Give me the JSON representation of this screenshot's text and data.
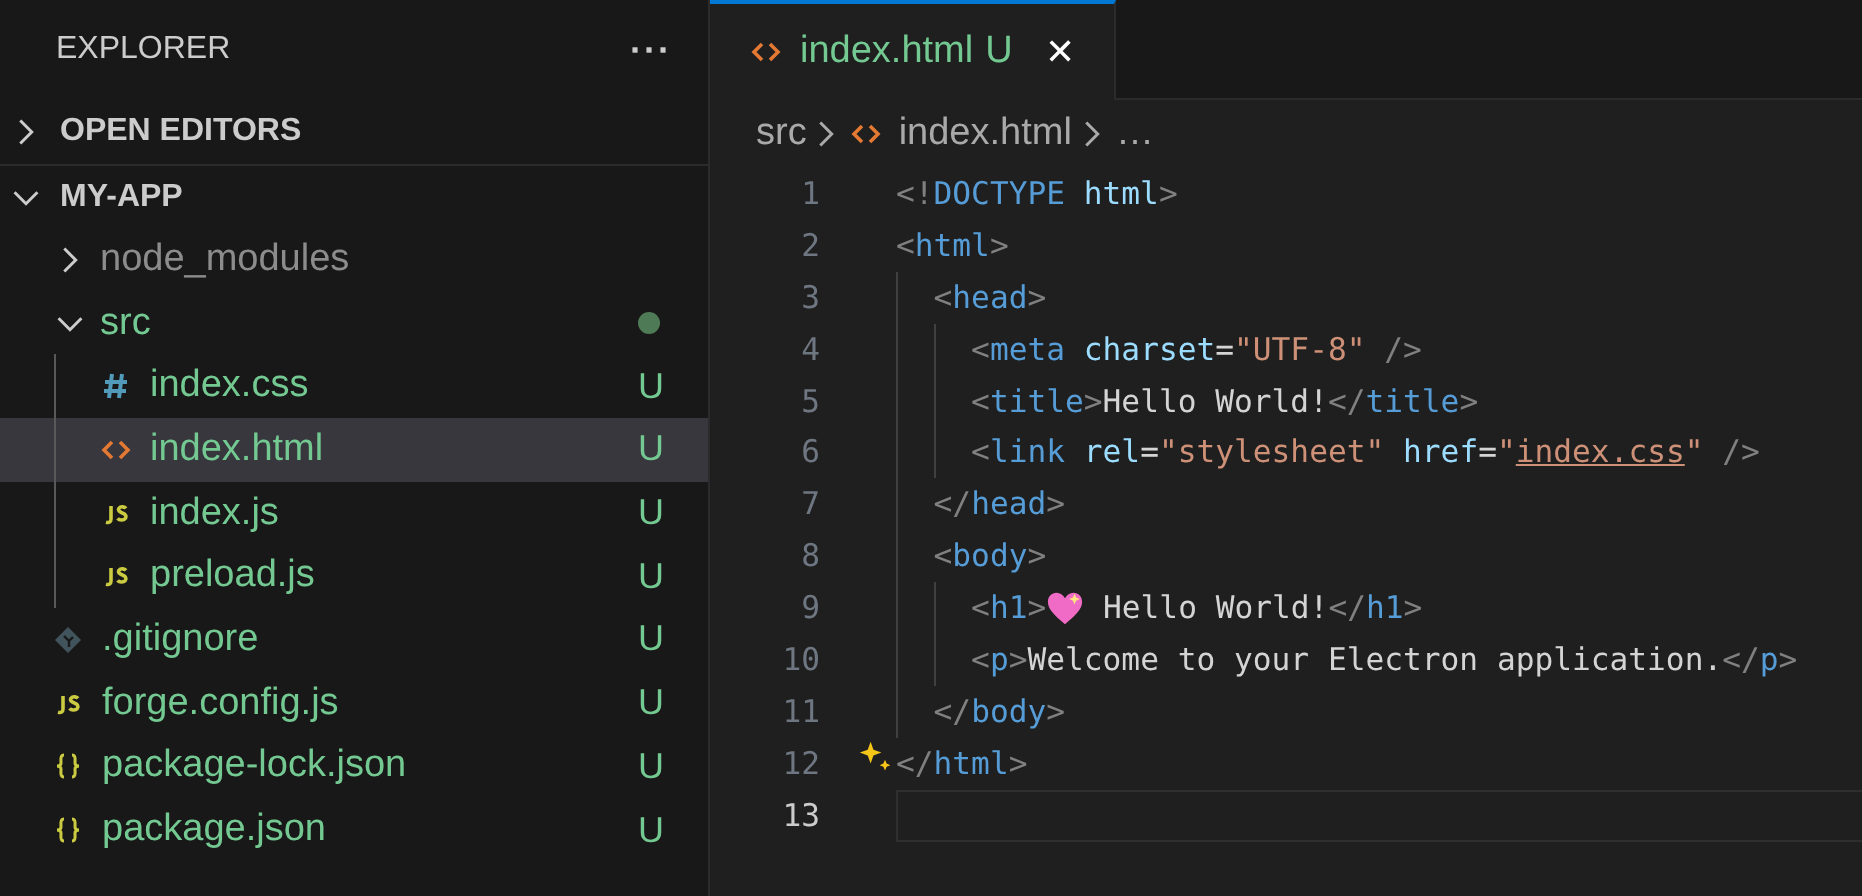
{
  "sidebar": {
    "title": "EXPLORER",
    "more": "···",
    "sections": [
      {
        "label": "OPEN EDITORS",
        "expanded": false
      },
      {
        "label": "MY-APP",
        "expanded": true,
        "items": [
          {
            "name": "node_modules",
            "kind": "folder",
            "expanded": false,
            "ignored": true,
            "selected": false
          },
          {
            "name": "src",
            "kind": "folder",
            "expanded": true,
            "ignored": false,
            "dot": true,
            "selected": false,
            "children": [
              {
                "name": "index.css",
                "kind": "css",
                "ignored": false,
                "badge": "U",
                "selected": false
              },
              {
                "name": "index.html",
                "kind": "html",
                "ignored": false,
                "badge": "U",
                "selected": true
              },
              {
                "name": "index.js",
                "kind": "js",
                "ignored": false,
                "badge": "U",
                "selected": false
              },
              {
                "name": "preload.js",
                "kind": "js",
                "ignored": false,
                "badge": "U",
                "selected": false
              }
            ]
          },
          {
            "name": ".gitignore",
            "kind": "git",
            "ignored": false,
            "badge": "U",
            "selected": false
          },
          {
            "name": "forge.config.js",
            "kind": "js",
            "ignored": false,
            "badge": "U",
            "selected": false
          },
          {
            "name": "package-lock.json",
            "kind": "json",
            "ignored": false,
            "badge": "U",
            "selected": false
          },
          {
            "name": "package.json",
            "kind": "json",
            "ignored": false,
            "badge": "U",
            "selected": false
          }
        ]
      }
    ]
  },
  "tabs": [
    {
      "label": "index.html",
      "kind": "html",
      "badge": "U",
      "close": "✕",
      "selected": true
    }
  ],
  "breadcrumb": [
    {
      "label": "src",
      "kind": "folder"
    },
    {
      "label": "index.html",
      "kind": "html"
    },
    {
      "label": "…",
      "kind": "more"
    }
  ],
  "code": [
    {
      "number": "1",
      "current": false,
      "tokens": [
        {
          "kind": "punct",
          "text": "<!"
        },
        {
          "kind": "tag",
          "text": "DOCTYPE"
        },
        {
          "kind": "attr",
          "text": " html"
        },
        {
          "kind": "punct",
          "text": ">"
        }
      ]
    },
    {
      "number": "2",
      "current": false,
      "tokens": [
        {
          "kind": "punct",
          "text": "<"
        },
        {
          "kind": "tag",
          "text": "html"
        },
        {
          "kind": "punct",
          "text": ">"
        }
      ]
    },
    {
      "number": "3",
      "current": false,
      "tokens": [
        {
          "kind": "punct",
          "text": "  <"
        },
        {
          "kind": "tag",
          "text": "head"
        },
        {
          "kind": "punct",
          "text": ">"
        }
      ]
    },
    {
      "number": "4",
      "current": false,
      "tokens": [
        {
          "kind": "punct",
          "text": "    <"
        },
        {
          "kind": "tag",
          "text": "meta"
        },
        {
          "kind": "attr",
          "text": " charset"
        },
        {
          "kind": "text",
          "text": "="
        },
        {
          "kind": "str",
          "text": "\"UTF-8\""
        },
        {
          "kind": "punct",
          "text": " />"
        }
      ]
    },
    {
      "number": "5",
      "current": false,
      "tokens": [
        {
          "kind": "punct",
          "text": "    <"
        },
        {
          "kind": "tag",
          "text": "title"
        },
        {
          "kind": "punct",
          "text": ">"
        },
        {
          "kind": "text",
          "text": "Hello World!"
        },
        {
          "kind": "punct",
          "text": "</"
        },
        {
          "kind": "tag",
          "text": "title"
        },
        {
          "kind": "punct",
          "text": ">"
        }
      ]
    },
    {
      "number": "6",
      "current": false,
      "tokens": [
        {
          "kind": "punct",
          "text": "    <"
        },
        {
          "kind": "tag",
          "text": "link"
        },
        {
          "kind": "attr",
          "text": " rel"
        },
        {
          "kind": "text",
          "text": "="
        },
        {
          "kind": "str",
          "text": "\"stylesheet\""
        },
        {
          "kind": "attr",
          "text": " href"
        },
        {
          "kind": "text",
          "text": "="
        },
        {
          "kind": "str",
          "text": "\""
        },
        {
          "kind": "link",
          "text": "index.css"
        },
        {
          "kind": "str",
          "text": "\""
        },
        {
          "kind": "punct",
          "text": " />"
        }
      ]
    },
    {
      "number": "7",
      "current": false,
      "tokens": [
        {
          "kind": "punct",
          "text": "  </"
        },
        {
          "kind": "tag",
          "text": "head"
        },
        {
          "kind": "punct",
          "text": ">"
        }
      ]
    },
    {
      "number": "8",
      "current": false,
      "tokens": [
        {
          "kind": "punct",
          "text": "  <"
        },
        {
          "kind": "tag",
          "text": "body"
        },
        {
          "kind": "punct",
          "text": ">"
        }
      ]
    },
    {
      "number": "9",
      "current": false,
      "tokens": [
        {
          "kind": "punct",
          "text": "    <"
        },
        {
          "kind": "tag",
          "text": "h1"
        },
        {
          "kind": "punct",
          "text": ">"
        },
        {
          "kind": "heart"
        },
        {
          "kind": "text",
          "text": " Hello World!"
        },
        {
          "kind": "punct",
          "text": "</"
        },
        {
          "kind": "tag",
          "text": "h1"
        },
        {
          "kind": "punct",
          "text": ">"
        }
      ]
    },
    {
      "number": "10",
      "current": false,
      "tokens": [
        {
          "kind": "punct",
          "text": "    <"
        },
        {
          "kind": "tag",
          "text": "p"
        },
        {
          "kind": "punct",
          "text": ">"
        },
        {
          "kind": "text",
          "text": "Welcome to your Electron application."
        },
        {
          "kind": "punct",
          "text": "</"
        },
        {
          "kind": "tag",
          "text": "p"
        },
        {
          "kind": "punct",
          "text": ">"
        }
      ]
    },
    {
      "number": "11",
      "current": false,
      "tokens": [
        {
          "kind": "punct",
          "text": "  </"
        },
        {
          "kind": "tag",
          "text": "body"
        },
        {
          "kind": "punct",
          "text": ">"
        }
      ]
    },
    {
      "number": "12",
      "current": false,
      "sparkle": true,
      "tokens": [
        {
          "kind": "punct",
          "text": "</"
        },
        {
          "kind": "tag",
          "text": "html"
        },
        {
          "kind": "punct",
          "text": ">"
        }
      ]
    },
    {
      "number": "13",
      "current": true
    }
  ]
}
